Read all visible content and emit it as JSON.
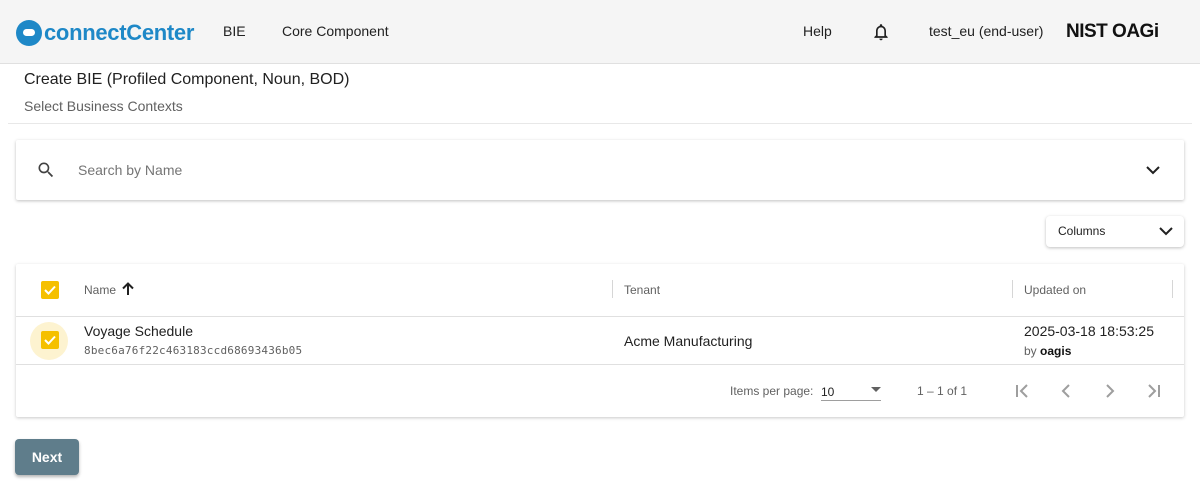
{
  "app": {
    "logo_text": "connectCenter",
    "nav": [
      {
        "label": "BIE"
      },
      {
        "label": "Core Component"
      }
    ],
    "help_label": "Help",
    "user_label": "test_eu (end-user)",
    "partner_logo_text": "NIST OAGi"
  },
  "page": {
    "title": "Create BIE (Profiled Component, Noun, BOD)",
    "subtitle": "Select Business Contexts"
  },
  "search": {
    "placeholder": "Search by Name",
    "value": ""
  },
  "columns_button": {
    "label": "Columns"
  },
  "table": {
    "headers": {
      "name": "Name",
      "tenant": "Tenant",
      "updated": "Updated on"
    },
    "sort": {
      "column": "Name",
      "direction": "ascending"
    },
    "select_all_checked": true,
    "rows": [
      {
        "checked": true,
        "name": "Voyage Schedule",
        "guid": "8bec6a76f22c463183ccd68693436b05",
        "tenant": "Acme Manufacturing",
        "updated_on": "2025-03-18 18:53:25",
        "by_prefix": "by",
        "by_user": "oagis"
      }
    ]
  },
  "paginator": {
    "items_per_page_label": "Items per page:",
    "items_per_page_value": "10",
    "range_label": "1 – 1 of 1"
  },
  "actions": {
    "next_label": "Next"
  },
  "colors": {
    "accent_checkbox": "#f5c000",
    "brand_blue": "#1e88c7",
    "next_button": "#5f7d8b"
  }
}
